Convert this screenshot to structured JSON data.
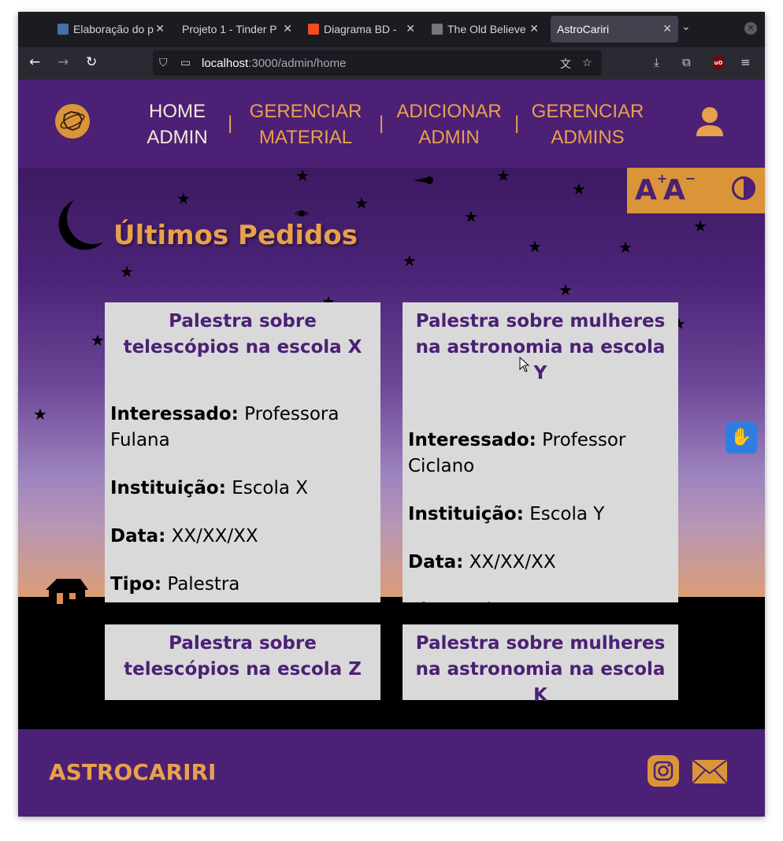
{
  "browser": {
    "tabs": [
      {
        "title": "Elaboração do p",
        "favicon_color": "#4a6fa5"
      },
      {
        "title": "Projeto 1 - Tinder P",
        "favicon_color": ""
      },
      {
        "title": "Diagrama BD - ",
        "favicon_color": "#f24e1e"
      },
      {
        "title": "The Old Believe",
        "favicon_color": "#777777"
      },
      {
        "title": "AstroCariri",
        "favicon_color": ""
      }
    ],
    "url_host": "localhost",
    "url_path": ":3000/admin/home"
  },
  "header": {
    "nav": [
      {
        "line1": "HOME",
        "line2": "ADMIN"
      },
      {
        "line1": "GERENCIAR",
        "line2": "MATERIAL"
      },
      {
        "line1": "ADICIONAR",
        "line2": "ADMIN"
      },
      {
        "line1": "GERENCIAR",
        "line2": "ADMINS"
      }
    ],
    "separator": "|"
  },
  "accessibility": {
    "increase_font": "A",
    "increase_sign": "+",
    "decrease_font": "A",
    "decrease_sign": "−"
  },
  "main": {
    "title": "Últimos Pedidos",
    "cards": [
      {
        "title": "Palestra sobre telescópios na escola X",
        "interessado_label": "Interessado:",
        "interessado": "Professora Fulana",
        "instituicao_label": "Instituição:",
        "instituicao": "Escola X",
        "data_label": "Data:",
        "data": "XX/XX/XX",
        "tipo_label": "Tipo:",
        "tipo": "Palestra"
      },
      {
        "title": "Palestra sobre mulheres na astronomia na escola Y",
        "interessado_label": "Interessado:",
        "interessado": "Professor Ciclano",
        "instituicao_label": "Instituição:",
        "instituicao": "Escola Y",
        "data_label": "Data:",
        "data": "XX/XX/XX",
        "tipo_label": "Tipo:",
        "tipo": "Palestra"
      },
      {
        "title": "Palestra sobre telescópios na escola Z"
      },
      {
        "title": "Palestra sobre mulheres na astronomia na escola K"
      }
    ]
  },
  "footer": {
    "brand": "ASTROCARIRI"
  },
  "colors": {
    "brand_purple": "#4b2075",
    "brand_orange": "#e7a14c",
    "card_bg": "#d9d9d9"
  }
}
